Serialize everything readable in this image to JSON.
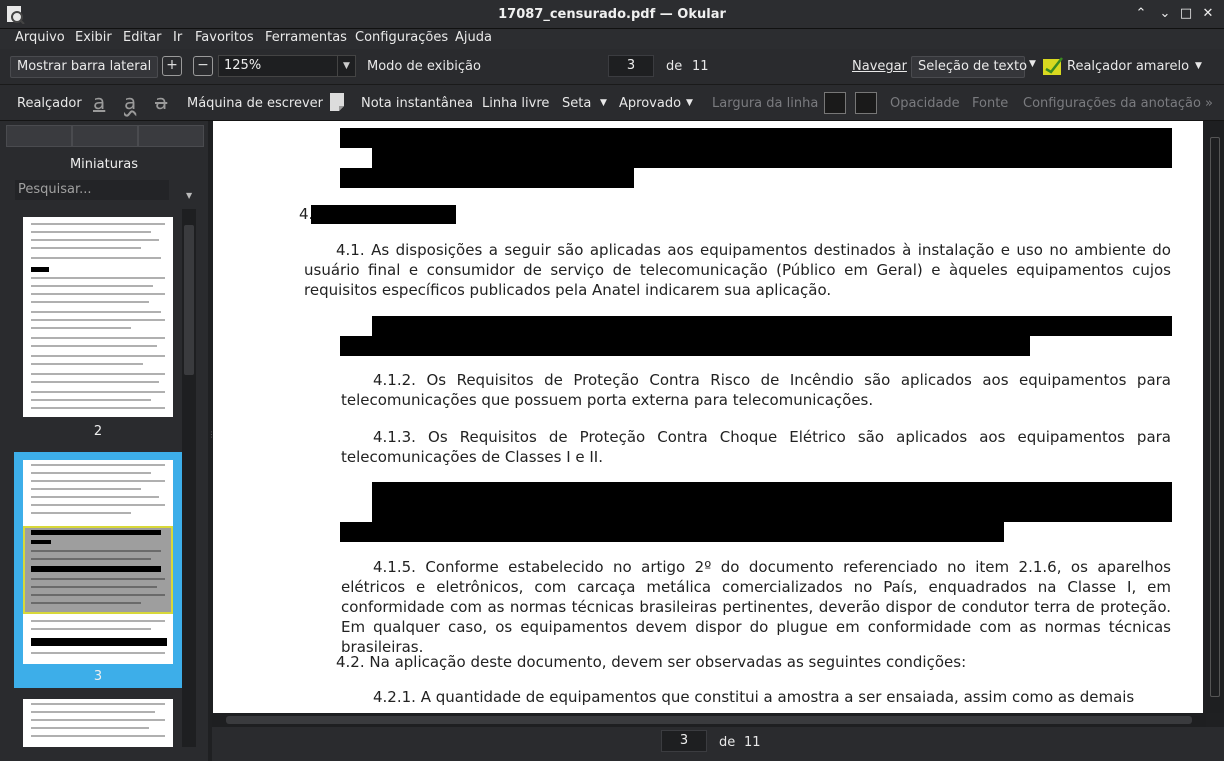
{
  "window": {
    "title": "17087_censurado.pdf  — Okular",
    "buttons": {
      "chevron": "⌃",
      "minimize": "⌄",
      "maximize": "□",
      "close": "✕"
    }
  },
  "menu": [
    "Arquivo",
    "Exibir",
    "Editar",
    "Ir",
    "Favoritos",
    "Ferramentas",
    "Configurações",
    "Ajuda"
  ],
  "toolbar": {
    "sidebar_toggle": "Mostrar barra lateral",
    "zoom": "125%",
    "view_mode": "Modo de exibição",
    "page_current": "3",
    "page_of": "de",
    "page_total": "11",
    "navigate": "Navegar",
    "text_selection": "Seleção de texto",
    "highlighter": "Realçador amarelo"
  },
  "annotation_bar": {
    "realcador": "Realçador",
    "typewriter": "Máquina de escrever",
    "note": "Nota instantânea",
    "freehand": "Linha livre",
    "arrow": "Seta",
    "stamp": "Aprovado",
    "line_width": "Largura da linha",
    "opacity": "Opacidade",
    "font": "Fonte",
    "annotation_settings": "Configurações da anotação"
  },
  "sidebar": {
    "title": "Miniaturas",
    "search_placeholder": "Pesquisar...",
    "thumbnails": [
      {
        "number": "2"
      },
      {
        "number": "3"
      }
    ]
  },
  "document": {
    "heading_num": "4.",
    "p41": "4.1. As disposições a seguir são aplicadas aos equipamentos destinados à instalação e uso no ambiente do usuário final e consumidor de serviço de telecomunicação (Público em Geral) e àqueles equipamentos cujos requisitos específicos publicados pela Anatel indicarem sua aplicação.",
    "p412": "4.1.2. Os Requisitos de Proteção Contra Risco de Incêndio são aplicados aos equipamentos para telecomunicações que possuem porta externa para telecomunicações.",
    "p413": "4.1.3. Os Requisitos de Proteção Contra Choque Elétrico são aplicados aos equipamentos para telecomunicações de Classes I e II.",
    "p415": "4.1.5. Conforme estabelecido no artigo 2º do documento referenciado no item 2.1.6, os aparelhos elétricos e eletrônicos, com carcaça metálica comercializados no País, enquadrados na Classe I, em conformidade com as normas técnicas brasileiras pertinentes, deverão dispor de condutor terra de proteção. Em qualquer caso, os equipamentos devem dispor do plugue em conformidade com as normas técnicas brasileiras.",
    "p42": "4.2. Na aplicação deste documento, devem ser observadas as seguintes condições:",
    "p421": "4.2.1. A quantidade de equipamentos que constitui a amostra a ser ensaiada, assim como as demais"
  },
  "bottom": {
    "page_current": "3",
    "page_of": "de",
    "page_total": "11"
  }
}
